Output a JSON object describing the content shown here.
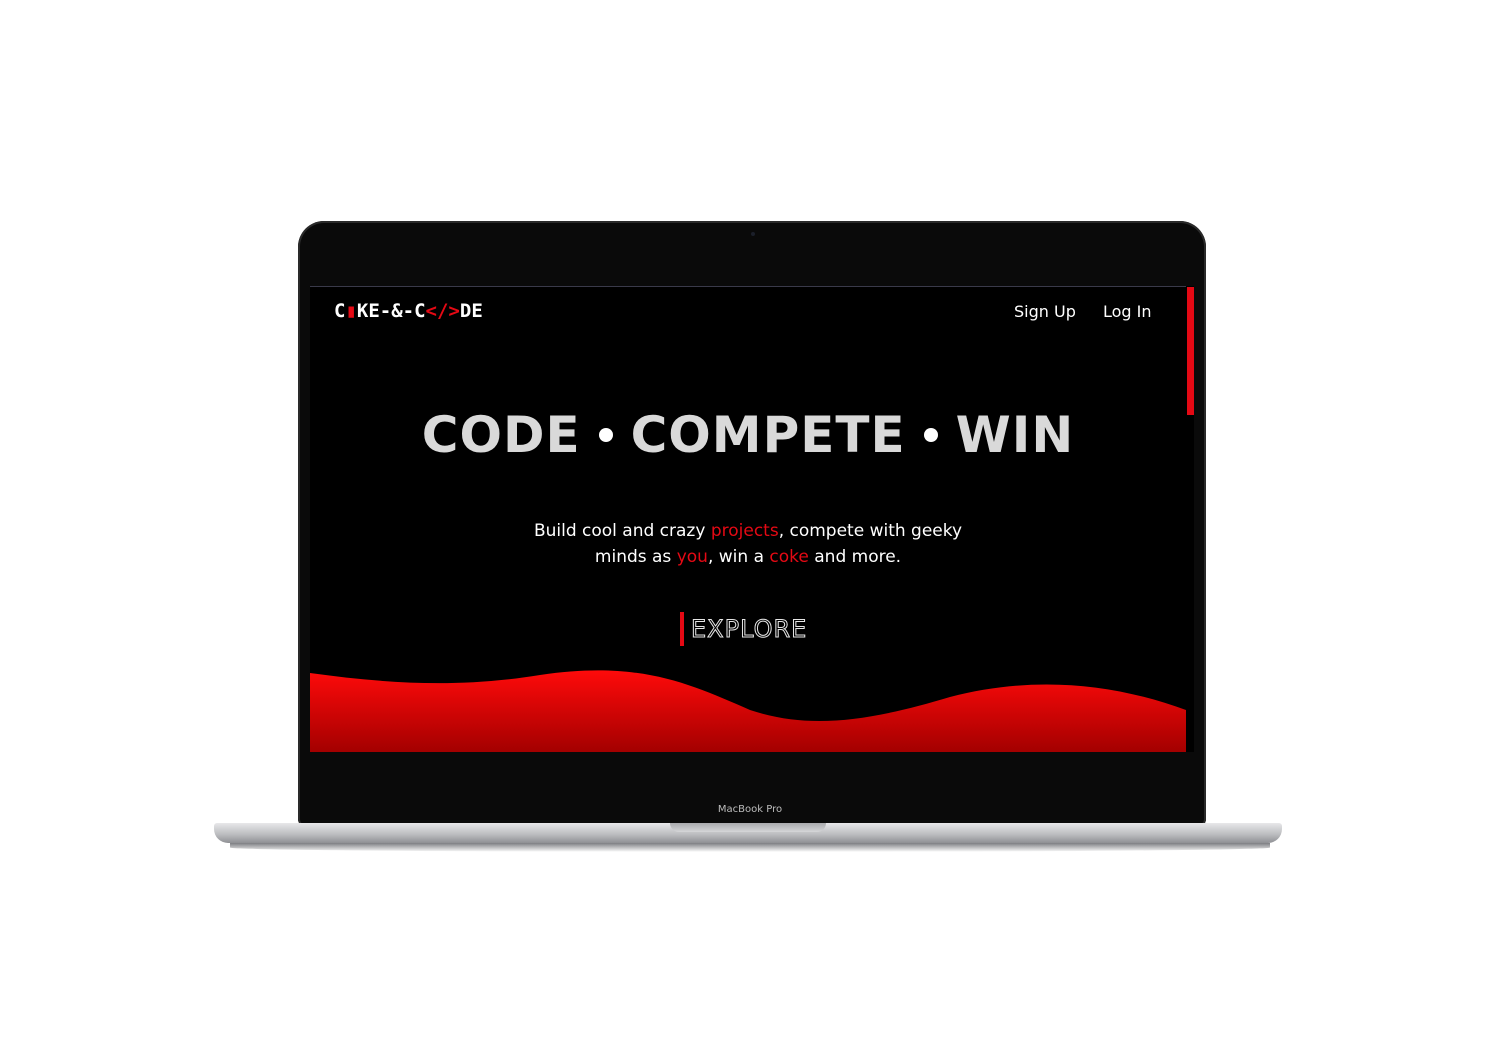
{
  "device": {
    "label": "MacBook Pro"
  },
  "site": {
    "logo": {
      "part1": "C",
      "part2": "▮",
      "part3": "KE-&-C",
      "part4": "</>",
      "part5": "DE"
    },
    "nav": {
      "signup": "Sign Up",
      "login": "Log In"
    },
    "hero": {
      "title_words": [
        "CODE",
        "COMPETE",
        "WIN"
      ],
      "subtitle": {
        "s1": "Build cool and crazy ",
        "h1": "projects",
        "s2": ", compete with geeky minds as ",
        "h2": "you",
        "s3": ", win a ",
        "h3": "coke",
        "s4": " and more."
      },
      "cta": "EXPLORE"
    }
  },
  "colors": {
    "accent": "#e50914",
    "background": "#000000",
    "text": "#ffffff"
  }
}
